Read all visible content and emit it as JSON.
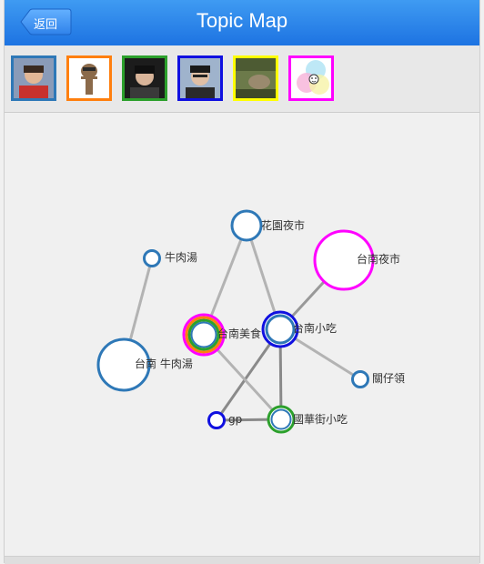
{
  "header": {
    "title": "Topic Map",
    "back_label": "返回"
  },
  "avatars": [
    {
      "name": "avatar-user-1",
      "border_color": "#2e78b7"
    },
    {
      "name": "avatar-user-2",
      "border_color": "#ff7f0e"
    },
    {
      "name": "avatar-user-3",
      "border_color": "#2ca02c"
    },
    {
      "name": "avatar-user-4",
      "border_color": "#1010e0"
    },
    {
      "name": "avatar-user-5",
      "border_color": "#ffff00"
    },
    {
      "name": "avatar-group",
      "border_color": "#ff00ff"
    }
  ],
  "topic_map": {
    "nodes": [
      {
        "id": "flower-market",
        "label": "花園夜市"
      },
      {
        "id": "beef-soup",
        "label": "牛肉湯"
      },
      {
        "id": "tainan-night-market",
        "label": "台南夜市"
      },
      {
        "id": "tainan-food",
        "label": "台南美食"
      },
      {
        "id": "tainan-snacks",
        "label": "台南小吃"
      },
      {
        "id": "tainan-beef-soup",
        "label": "台南 牛肉湯"
      },
      {
        "id": "guanziling",
        "label": "關仔領"
      },
      {
        "id": "gp",
        "label": "gp"
      },
      {
        "id": "guohua-street",
        "label": "國華街小吃"
      }
    ],
    "colors": {
      "blue": "#2e78b7",
      "magenta": "#ff00ff",
      "orange": "#ff7f0e",
      "green": "#2ca02c",
      "darkblue": "#1010e0",
      "edge": "#b3b3b3",
      "edge_dark": "#8a8a8a"
    }
  }
}
